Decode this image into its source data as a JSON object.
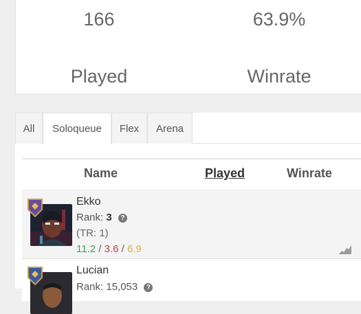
{
  "stats": {
    "played_value": "166",
    "played_label": "Played",
    "winrate_value": "63.9%",
    "winrate_label": "Winrate"
  },
  "tabs": [
    {
      "label": "All",
      "active": false
    },
    {
      "label": "Soloqueue",
      "active": true
    },
    {
      "label": "Flex",
      "active": false
    },
    {
      "label": "Arena",
      "active": false
    }
  ],
  "table": {
    "headers": {
      "name": "Name",
      "played": "Played",
      "winrate": "Winrate"
    },
    "rows": [
      {
        "champion": "Ekko",
        "rank_label": "Rank:",
        "rank_value": "3",
        "tr": "(TR: 1)",
        "kda": {
          "kills": "11.2",
          "deaths": "3.6",
          "assists": "6.9",
          "separator": "/"
        }
      },
      {
        "champion": "Lucian",
        "rank_label": "Rank:",
        "rank_value": "15,053"
      }
    ]
  },
  "icons": {
    "help": "question-circle-icon",
    "trend": "trend-chart-icon",
    "badge": "mastery-badge-icon"
  },
  "colors": {
    "kills": "#3aa060",
    "deaths": "#c8403a",
    "assists": "#e0b040",
    "badge": "#6a4a9a"
  }
}
